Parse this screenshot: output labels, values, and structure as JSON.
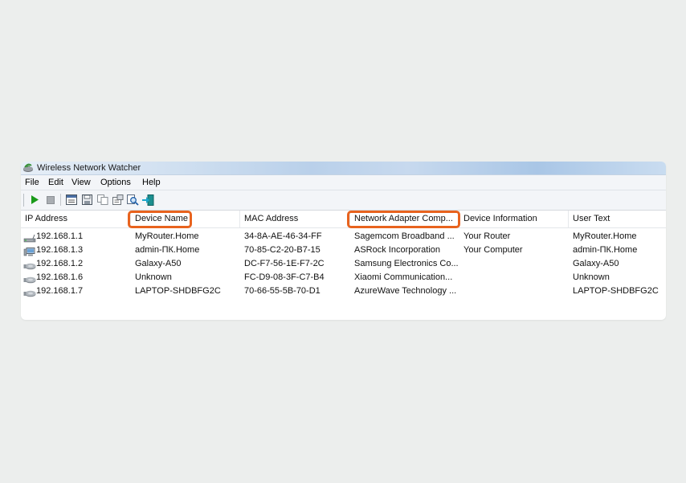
{
  "window": {
    "title": "Wireless Network Watcher"
  },
  "menu": [
    "File",
    "Edit",
    "View",
    "Options",
    "Help"
  ],
  "toolbar": {
    "buttons": [
      "play-icon",
      "stop-icon",
      "html-report-icon",
      "save-icon",
      "copy-icon",
      "properties-icon",
      "find-icon",
      "exit-icon"
    ]
  },
  "colors": {
    "highlight": "#e8631e",
    "play": "#1a9a1a"
  },
  "columns": [
    "IP Address",
    "Device Name",
    "MAC Address",
    "Network Adapter Comp...",
    "Device Information",
    "User Text"
  ],
  "highlighted_columns": [
    "Device Name",
    "Network Adapter Comp..."
  ],
  "rows": [
    {
      "icon": "router-icon",
      "ip": "192.168.1.1",
      "name": "MyRouter.Home",
      "mac": "34-8A-AE-46-34-FF",
      "adapter": "Sagemcom Broadband ...",
      "info": "Your Router",
      "user": "MyRouter.Home"
    },
    {
      "icon": "computer-icon",
      "ip": "192.168.1.3",
      "name": "admin-ПК.Home",
      "mac": "70-85-C2-20-B7-15",
      "adapter": "ASRock Incorporation",
      "info": "Your Computer",
      "user": "admin-ПК.Home"
    },
    {
      "icon": "device-icon",
      "ip": "192.168.1.2",
      "name": "Galaxy-A50",
      "mac": "DC-F7-56-1E-F7-2C",
      "adapter": "Samsung Electronics Co...",
      "info": "",
      "user": "Galaxy-A50"
    },
    {
      "icon": "device-icon",
      "ip": "192.168.1.6",
      "name": "Unknown",
      "mac": "FC-D9-08-3F-C7-B4",
      "adapter": "Xiaomi Communication...",
      "info": "",
      "user": "Unknown"
    },
    {
      "icon": "device-icon",
      "ip": "192.168.1.7",
      "name": "LAPTOP-SHDBFG2C",
      "mac": "70-66-55-5B-70-D1",
      "adapter": "AzureWave Technology ...",
      "info": "",
      "user": "LAPTOP-SHDBFG2C"
    }
  ]
}
